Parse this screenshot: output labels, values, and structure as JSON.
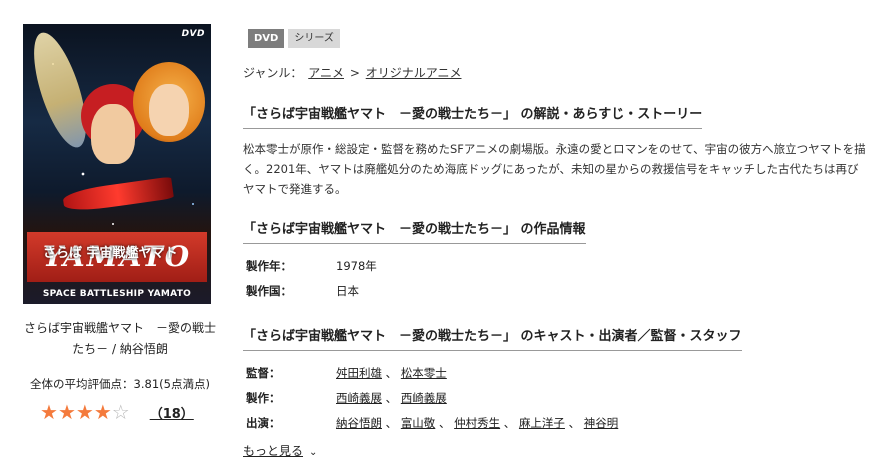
{
  "poster": {
    "dvd_mark": "DVD",
    "logo_text": "YAMATO",
    "logo_jp": "さらば 宇宙戦艦ヤマト",
    "subtitle": "SPACE BATTLESHIP YAMATO"
  },
  "product_title": "さらば宇宙戦艦ヤマト　－愛の戦士たち－ / 納谷悟朗",
  "average_rating_text": "全体の平均評価点：3.81(5点満点)",
  "rating": {
    "filled": 4,
    "total": 5,
    "review_count": "（18）"
  },
  "badges": [
    "DVD",
    "シリーズ"
  ],
  "genre": {
    "label": "ジャンル：",
    "items": [
      "アニメ",
      "オリジナルアニメ"
    ],
    "separator": ">"
  },
  "sections": {
    "story_title": "「さらば宇宙戦艦ヤマト　－愛の戦士たち－」 の解説・あらすじ・ストーリー",
    "story_text": "松本零士が原作・総設定・監督を務めたSFアニメの劇場版。永遠の愛とロマンをのせて、宇宙の彼方へ旅立つヤマトを描く。2201年、ヤマトは廃艦処分のため海底ドッグにあったが、未知の星からの救援信号をキャッチした古代たちは再びヤマトで発進する。",
    "info_title": "「さらば宇宙戦艦ヤマト　－愛の戦士たち－」 の作品情報",
    "cast_title": "「さらば宇宙戦艦ヤマト　－愛の戦士たち－」 のキャスト・出演者／監督・スタッフ"
  },
  "work_info": [
    {
      "key": "製作年：",
      "value": "1978年"
    },
    {
      "key": "製作国：",
      "value": "日本"
    }
  ],
  "staff": [
    {
      "key": "監督：",
      "names": [
        "舛田利雄",
        "松本零士"
      ]
    },
    {
      "key": "製作：",
      "names": [
        "西崎義展",
        "西崎義展"
      ]
    },
    {
      "key": "出演：",
      "names": [
        "納谷悟朗",
        "富山敬",
        "仲村秀生",
        "麻上洋子",
        "神谷明"
      ]
    }
  ],
  "more_label": "もっと見る",
  "colors": {
    "star": "#f47a3c",
    "badge_dvd": "#7d7d7d",
    "badge_series": "#d8d8d8"
  }
}
